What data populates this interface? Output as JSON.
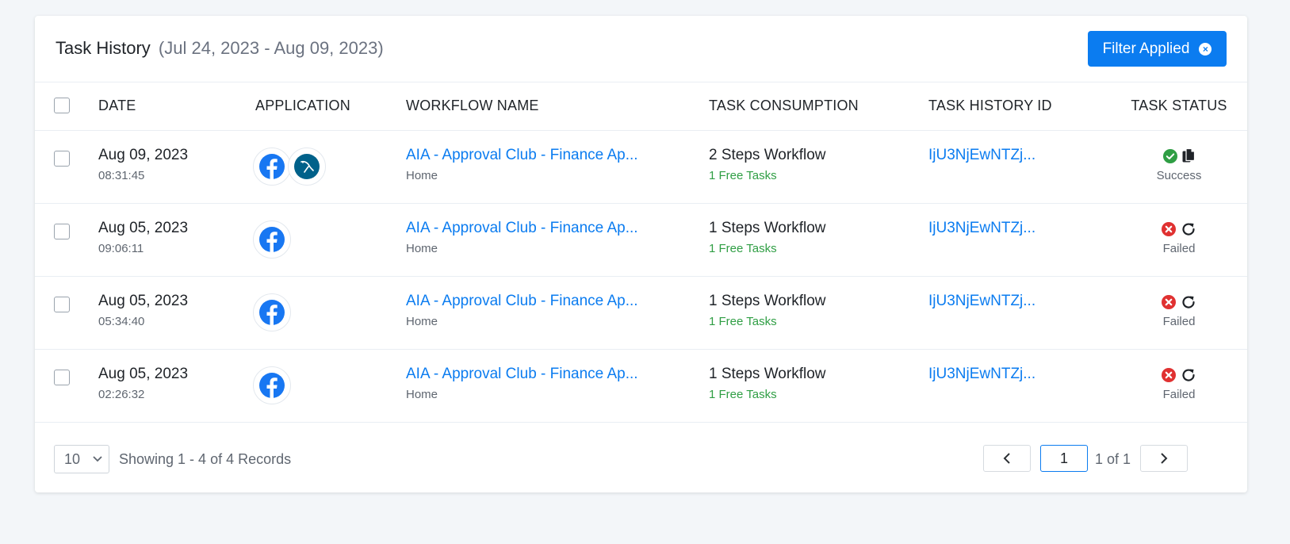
{
  "header": {
    "title": "Task History",
    "range": "(Jul 24, 2023 - Aug 09, 2023)",
    "filter_label": "Filter Applied"
  },
  "columns": {
    "date": "DATE",
    "application": "APPLICATION",
    "workflow": "WORKFLOW NAME",
    "consumption": "TASK CONSUMPTION",
    "history_id": "TASK HISTORY ID",
    "status": "TASK STATUS"
  },
  "rows": [
    {
      "date": "Aug 09, 2023",
      "time": "08:31:45",
      "apps": [
        "facebook-icon",
        "mysql-icon"
      ],
      "workflow": "AIA - Approval Club - Finance Ap...",
      "folder": "Home",
      "steps": "2 Steps Workflow",
      "free": "1 Free Tasks",
      "history_id": "IjU3NjEwNTZj...",
      "status": "Success",
      "status_color": "#2f9e44"
    },
    {
      "date": "Aug 05, 2023",
      "time": "09:06:11",
      "apps": [
        "facebook-icon"
      ],
      "workflow": "AIA - Approval Club - Finance Ap...",
      "folder": "Home",
      "steps": "1 Steps Workflow",
      "free": "1 Free Tasks",
      "history_id": "IjU3NjEwNTZj...",
      "status": "Failed",
      "status_color": "#e03131"
    },
    {
      "date": "Aug 05, 2023",
      "time": "05:34:40",
      "apps": [
        "facebook-icon"
      ],
      "workflow": "AIA - Approval Club - Finance Ap...",
      "folder": "Home",
      "steps": "1 Steps Workflow",
      "free": "1 Free Tasks",
      "history_id": "IjU3NjEwNTZj...",
      "status": "Failed",
      "status_color": "#e03131"
    },
    {
      "date": "Aug 05, 2023",
      "time": "02:26:32",
      "apps": [
        "facebook-icon"
      ],
      "workflow": "AIA - Approval Club - Finance Ap...",
      "folder": "Home",
      "steps": "1 Steps Workflow",
      "free": "1 Free Tasks",
      "history_id": "IjU3NjEwNTZj...",
      "status": "Failed",
      "status_color": "#e03131"
    }
  ],
  "footer": {
    "page_size": "10",
    "records": "Showing 1 - 4 of 4 Records",
    "current_page": "1",
    "page_of": "1 of 1"
  },
  "colors": {
    "accent": "#0b7cf0",
    "success": "#2f9e44",
    "failed": "#e03131",
    "facebook": "#1877f2",
    "mysql": "#00618a"
  }
}
